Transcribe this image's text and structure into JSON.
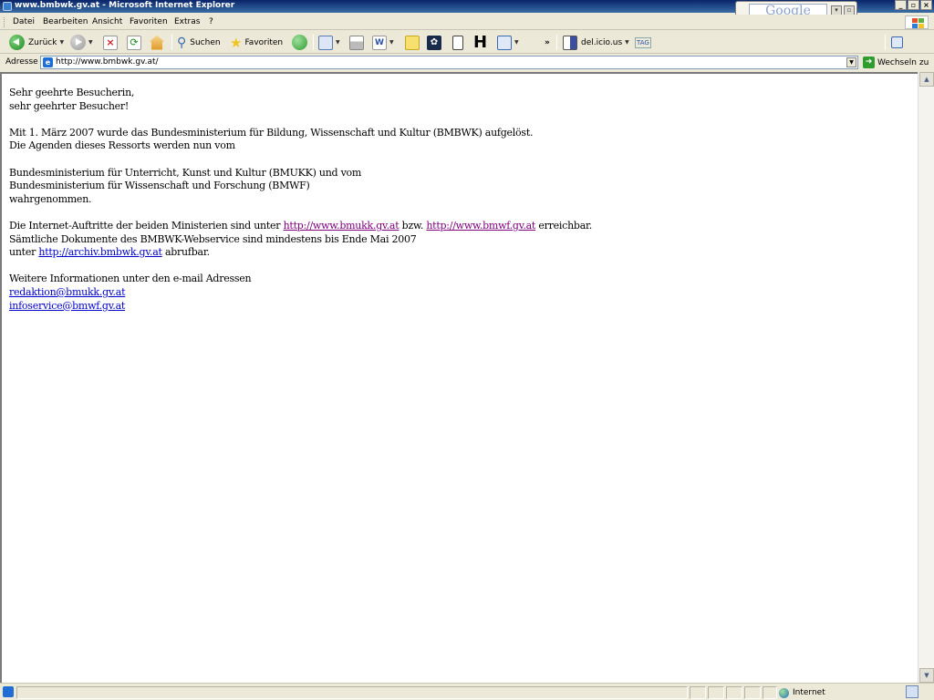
{
  "window": {
    "title": "www.bmbwk.gv.at - Microsoft Internet Explorer",
    "google_widget": "Google"
  },
  "menu": [
    "Datei",
    "Bearbeiten",
    "Ansicht",
    "Favoriten",
    "Extras",
    "?"
  ],
  "toolbar": {
    "back_label": "Zurück",
    "search_label": "Suchen",
    "favorites_label": "Favoriten",
    "delicious_label": "del.icio.us",
    "tag_label": "TAG",
    "overflow": "»"
  },
  "address": {
    "label": "Adresse",
    "url": "http://www.bmbwk.gv.at/",
    "go_label": "Wechseln zu"
  },
  "page": {
    "greeting": [
      "Sehr geehrte Besucherin,",
      "sehr geehrter Besucher!"
    ],
    "intro": [
      "Mit 1. März 2007 wurde das Bundesministerium für Bildung, Wissenschaft und Kultur (BMBWK) aufgelöst.",
      "Die Agenden dieses Ressorts werden nun vom"
    ],
    "ministries": [
      "Bundesministerium für Unterricht, Kunst und Kultur (BMUKK) und vom",
      "Bundesministerium für Wissenschaft und Forschung (BMWF)",
      "wahrgenommen."
    ],
    "links_para": {
      "prefix": "Die Internet-Auftritte der beiden Ministerien sind unter ",
      "link1": "http://www.bmukk.gv.at",
      "mid": " bzw. ",
      "link2": "http://www.bmwf.gv.at",
      "suffix": " erreichbar.",
      "line2": "Sämtliche Dokumente des BMBWK-Webservice sind mindestens bis Ende Mai 2007",
      "line3_prefix": "unter ",
      "archive_link": "http://archiv.bmbwk.gv.at",
      "line3_suffix": " abrufbar."
    },
    "contact": {
      "intro": "Weitere Informationen unter den e-mail Adressen",
      "email1": "redaktion@bmukk.gv.at",
      "email2": "infoservice@bmwf.gv.at"
    }
  },
  "status": {
    "zone": "Internet"
  },
  "colors": {
    "link_visited": "#800080",
    "link_unvisited": "#0000cc",
    "titlebar": "#0a246a"
  }
}
